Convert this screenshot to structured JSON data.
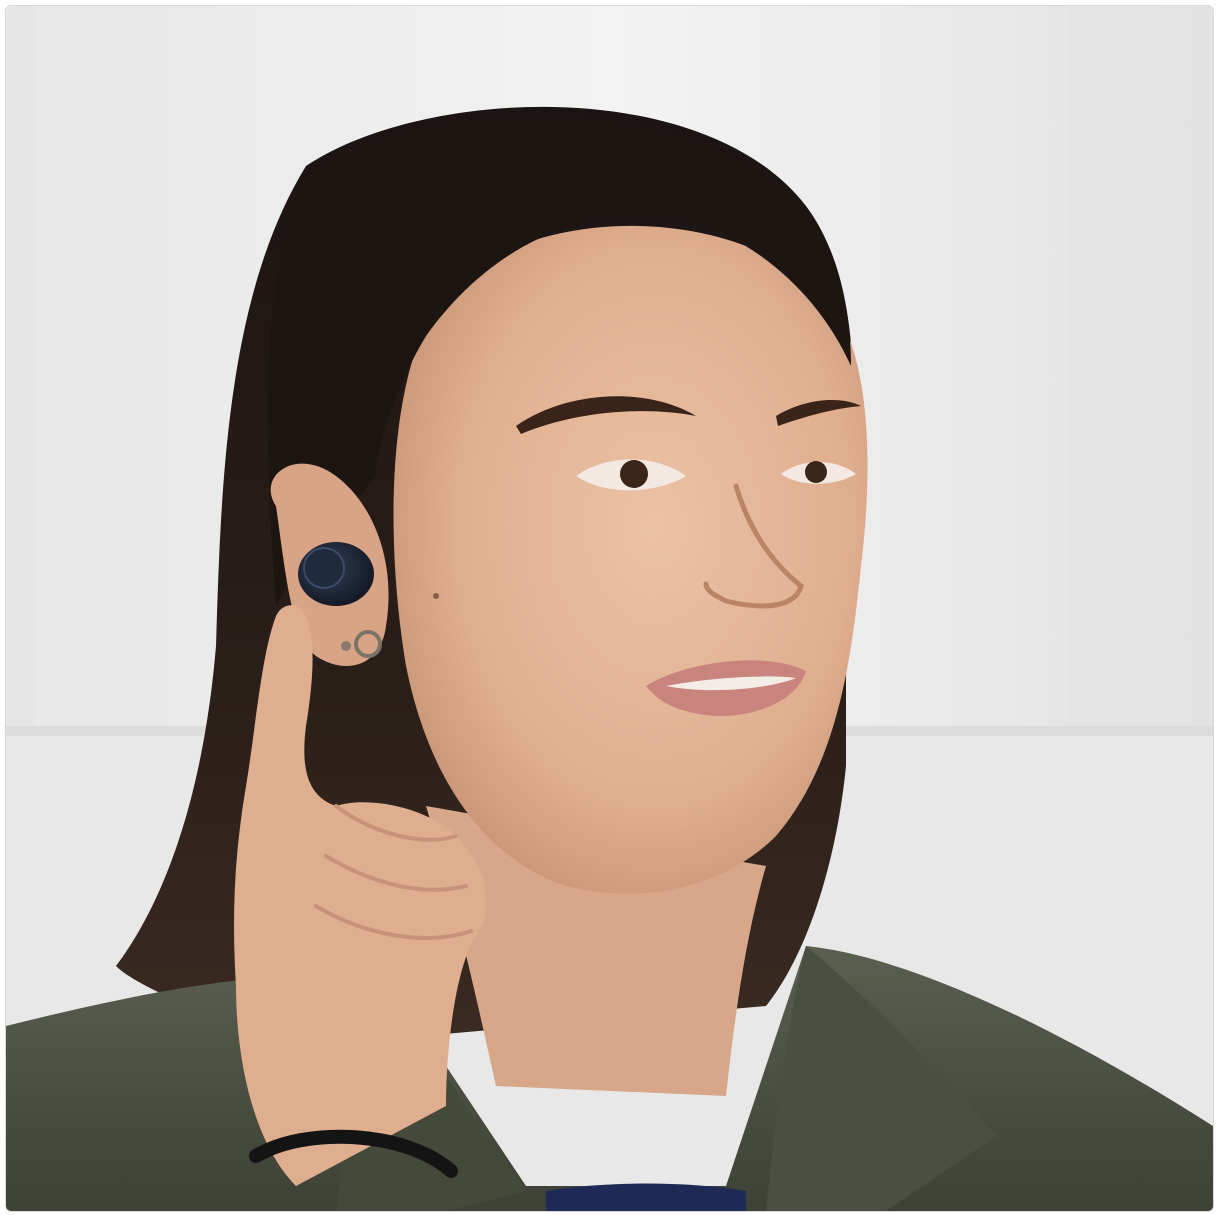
{
  "image": {
    "subject": "woman-touching-wireless-earbud",
    "icons": [
      "earbud-icon"
    ],
    "colors": {
      "wall": "#eeeeee",
      "wall_shadow": "#dcdcdc",
      "hair": "#1e1714",
      "skin": "#e3b597",
      "skin_shadow": "#c9977a",
      "jacket": "#4f5446",
      "jacket_dark": "#3b3f34",
      "shirt": "#1e2a55",
      "earbud": "#1b2433",
      "lips": "#c9847e",
      "hair_tie": "#141414"
    }
  }
}
